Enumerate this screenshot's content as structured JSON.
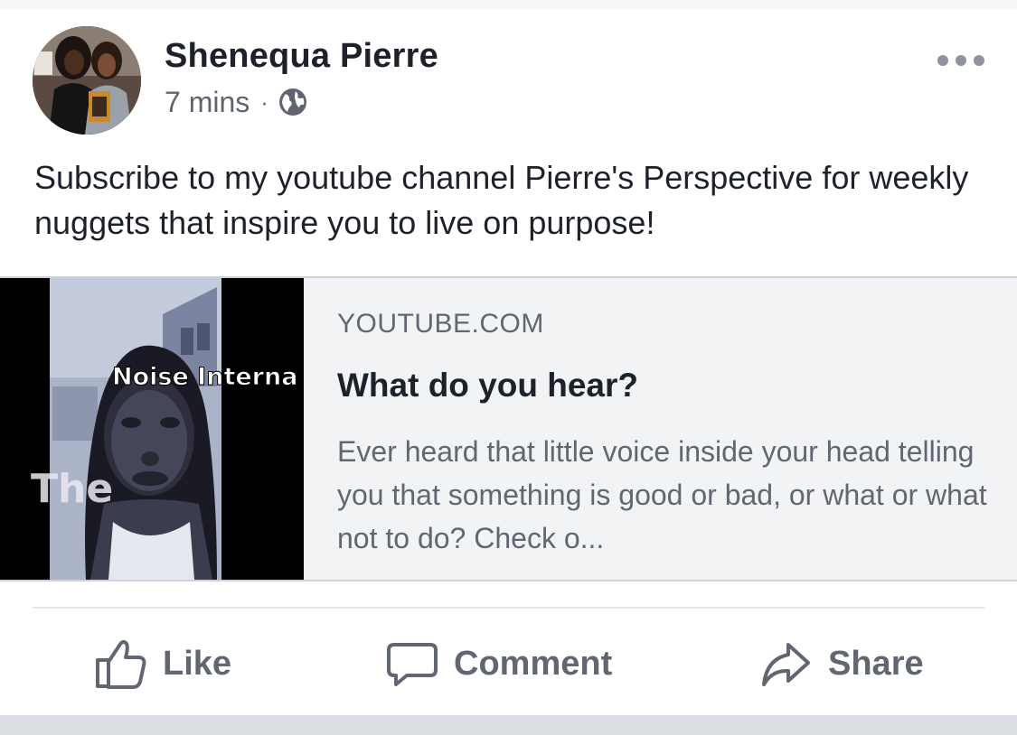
{
  "post": {
    "author": "Shenequa Pierre",
    "timestamp": "7 mins",
    "separator": "·",
    "privacy_icon": "globe-icon",
    "more_icon": "more-options-icon",
    "text": "Subscribe to my youtube channel Pierre's Perspective for weekly nuggets that inspire you to live on purpose!"
  },
  "link_preview": {
    "thumbnail_overlay": [
      "Noise Interna",
      "The"
    ],
    "domain": "YOUTUBE.COM",
    "title": "What do you hear?",
    "description": "Ever heard that little voice inside your head telling you that something is good or bad, or what or what not to do? Check o..."
  },
  "actions": {
    "like_label": "Like",
    "comment_label": "Comment",
    "share_label": "Share",
    "icons": [
      "thumbs-up-icon",
      "comment-bubble-icon",
      "share-arrow-icon"
    ]
  },
  "colors": {
    "text_primary": "#1d2129",
    "text_secondary": "#606770",
    "card_background": "#f2f3f5"
  }
}
